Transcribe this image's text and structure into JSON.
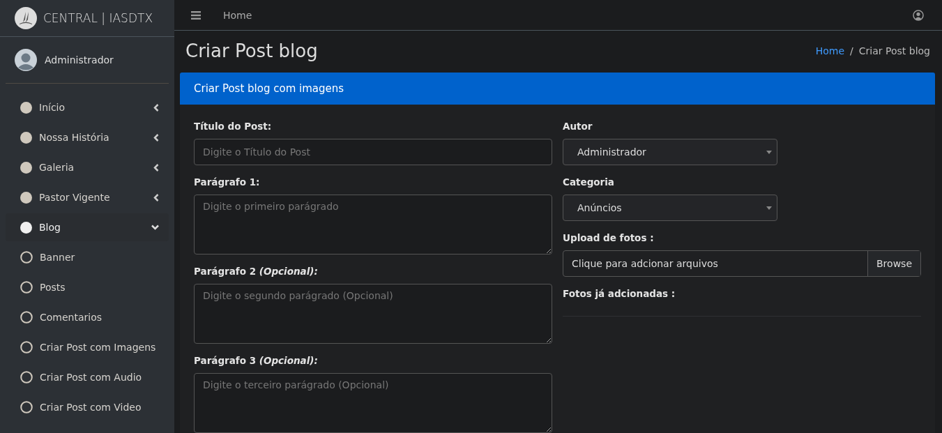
{
  "brand": {
    "name": "CENTRAL | IASDTX"
  },
  "topbar": {
    "nav_link": "Home"
  },
  "user": {
    "name": "Administrador"
  },
  "sidebar": {
    "items": [
      {
        "kind": "parent",
        "label": "Início",
        "selected": false,
        "expanded": false
      },
      {
        "kind": "parent",
        "label": "Nossa História",
        "selected": false,
        "expanded": false
      },
      {
        "kind": "parent",
        "label": "Galeria",
        "selected": false,
        "expanded": false
      },
      {
        "kind": "parent",
        "label": "Pastor Vigente",
        "selected": false,
        "expanded": false
      },
      {
        "kind": "parent",
        "label": "Blog",
        "selected": true,
        "expanded": true
      },
      {
        "kind": "child",
        "label": "Banner",
        "selected": false
      },
      {
        "kind": "child",
        "label": "Posts",
        "selected": false
      },
      {
        "kind": "child",
        "label": "Comentarios",
        "selected": false
      },
      {
        "kind": "child",
        "label": "Criar Post com Imagens",
        "selected": false
      },
      {
        "kind": "child",
        "label": "Criar Post com Audio",
        "selected": false
      },
      {
        "kind": "child",
        "label": "Criar Post com Video",
        "selected": false
      }
    ]
  },
  "page": {
    "title": "Criar Post blog",
    "breadcrumb": [
      "Home",
      "Criar Post blog"
    ],
    "breadcrumb_separator": "/"
  },
  "card": {
    "title": "Criar Post blog com imagens",
    "left_fields": [
      {
        "kind": "input",
        "label": "Título do Post:",
        "placeholder": "Digite o Título do Post"
      },
      {
        "kind": "textarea",
        "label": "Parágrafo 1:",
        "placeholder": "Digite o primeiro parágrado"
      },
      {
        "kind": "textarea",
        "label": "Parágrafo 2 *(Opcional):*",
        "placeholder": "Digite o segundo parágrado (Opcional)"
      },
      {
        "kind": "textarea",
        "label": "Parágrafo 3 *(Opcional):*",
        "placeholder": "Digite o terceiro parágrado (Opcional)"
      }
    ],
    "right_fields": [
      {
        "kind": "select",
        "label": "Autor",
        "value": "Administrador"
      },
      {
        "kind": "select",
        "label": "Categoria",
        "value": "Anúncios"
      },
      {
        "kind": "file",
        "label": "Upload de fotos :",
        "value": "Clique para adcionar arquivos",
        "button": "Browse"
      },
      {
        "kind": "heading",
        "label": "Fotos já adcionadas :"
      }
    ]
  }
}
